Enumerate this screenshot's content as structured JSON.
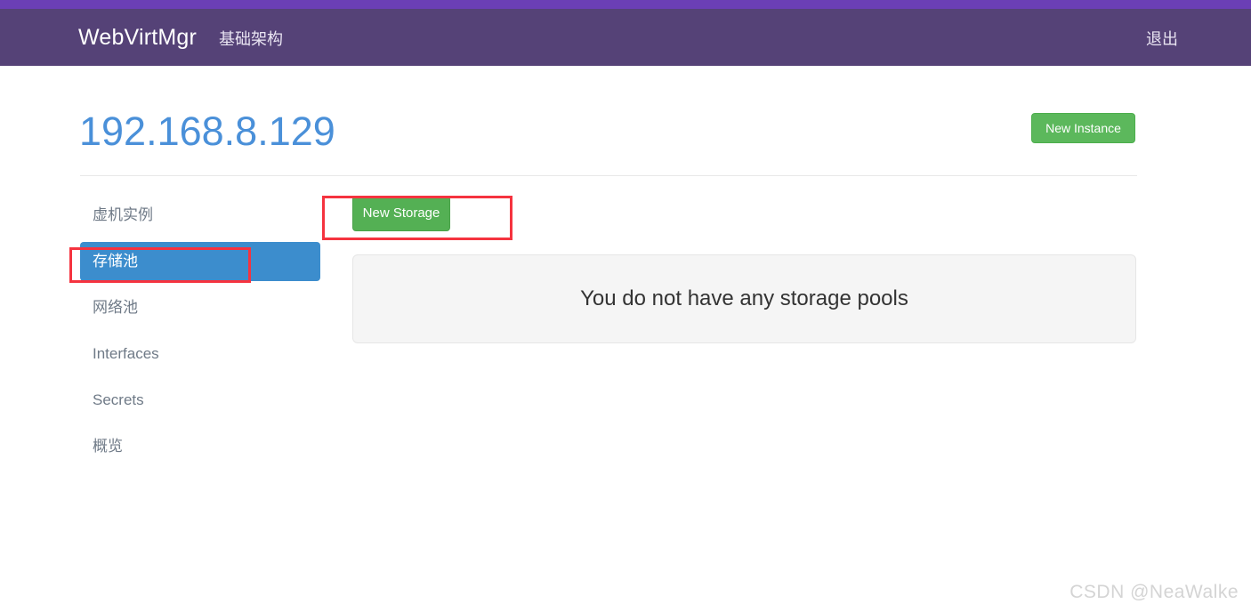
{
  "navbar": {
    "brand": "WebVirtMgr",
    "primary_link": "基础架构",
    "logout_link": "退出",
    "accent_color": "#6b3fb5",
    "background_color": "#554277"
  },
  "page_header": {
    "title": "192.168.8.129",
    "title_color": "#4a90d9",
    "new_instance_label": "New Instance",
    "new_instance_color": "#5cb85c"
  },
  "sidebar": {
    "items": [
      {
        "label": "虚机实例",
        "active": false
      },
      {
        "label": "存储池",
        "active": true
      },
      {
        "label": "网络池",
        "active": false
      },
      {
        "label": "Interfaces",
        "active": false
      },
      {
        "label": "Secrets",
        "active": false
      },
      {
        "label": "概览",
        "active": false
      }
    ],
    "active_color": "#3c8dcd"
  },
  "main": {
    "new_storage_label": "New Storage",
    "new_storage_color": "#54b054",
    "empty_message": "You do not have any storage pools"
  },
  "annotations": {
    "color": "#f5333f",
    "highlight_new_storage": "new-storage-button",
    "highlight_sidebar_item": "storage-pool-sidebar-item"
  },
  "watermark": {
    "text": "CSDN @NeaWalke"
  }
}
